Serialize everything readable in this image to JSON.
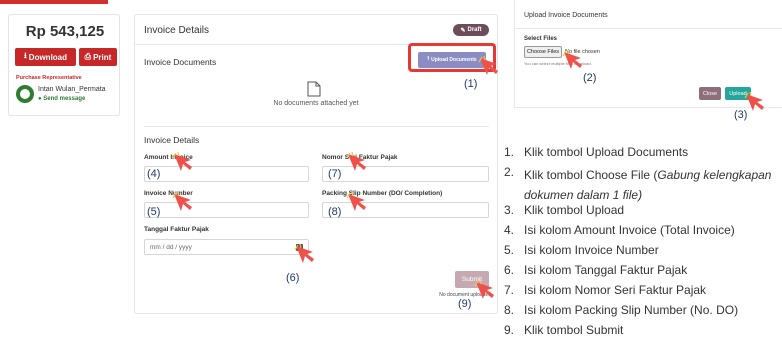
{
  "summary": {
    "price": "Rp 543,125",
    "download_label": "Download",
    "print_label": "Print",
    "purchase_rep_label": "Purchase Representative",
    "rep_name": "Intan Wulan_Permata",
    "send_message_label": "Send message"
  },
  "invoice": {
    "title": "Invoice Details",
    "draft_badge": "Draft",
    "documents_label": "Invoice Documents",
    "upload_documents_label": "Upload Documents",
    "no_documents_text": "No documents attached yet",
    "details_label": "Invoice Details",
    "fields": {
      "amount_invoice_label": "Amount Invoice",
      "invoice_number_label": "Invoice Number",
      "tanggal_faktur_label": "Tanggal Faktur Pajak",
      "tanggal_faktur_placeholder": "mm / dd / yyyy",
      "nomor_seri_label": "Nomor Seri Faktur Pajak",
      "packing_slip_label": "Packing Slip Number (DO/ Completion)"
    },
    "submit_label": "Submit",
    "no_document_uploaded": "No document uploaded"
  },
  "modal": {
    "title": "Upload Invoice Documents",
    "select_files_label": "Select Files",
    "choose_file_label": "Choose Files",
    "no_file_text": "No file chosen",
    "hint_text": "You can select multiple files to upload.",
    "close_label": "Close",
    "upload_label": "Upload"
  },
  "callouts": [
    "(1)",
    "(2)",
    "(3)",
    "(4)",
    "(5)",
    "(6)",
    "(7)",
    "(8)",
    "(9)"
  ],
  "steps": [
    {
      "num": "1.",
      "text": "Klik tombol Upload Documents"
    },
    {
      "num": "2.",
      "text_a": "Klik tombol Choose File (",
      "text_italic": "Gabung kelengkapan",
      "text_b": "dokumen dalam 1 file)"
    },
    {
      "num": "3.",
      "text": "Klik tombol Upload"
    },
    {
      "num": "4.",
      "text": "Isi kolom Amount Invoice (Total Invoice)"
    },
    {
      "num": "5.",
      "text": "Isi kolom Invoice Number"
    },
    {
      "num": "6.",
      "text": "Isi kolom Tanggal Faktur Pajak"
    },
    {
      "num": "7.",
      "text": "Isi kolom Nomor Seri Faktur Pajak"
    },
    {
      "num": "8.",
      "text": "Isi kolom Packing Slip Number (No. DO)"
    },
    {
      "num": "9.",
      "text": "Klik tombol Submit"
    }
  ],
  "colors": {
    "accent_red": "#c62828",
    "highlight_red": "#e53935",
    "pointer_red": "#f0504a",
    "callout_blue": "#1f3a6b",
    "upload_teal": "#26a69a"
  }
}
